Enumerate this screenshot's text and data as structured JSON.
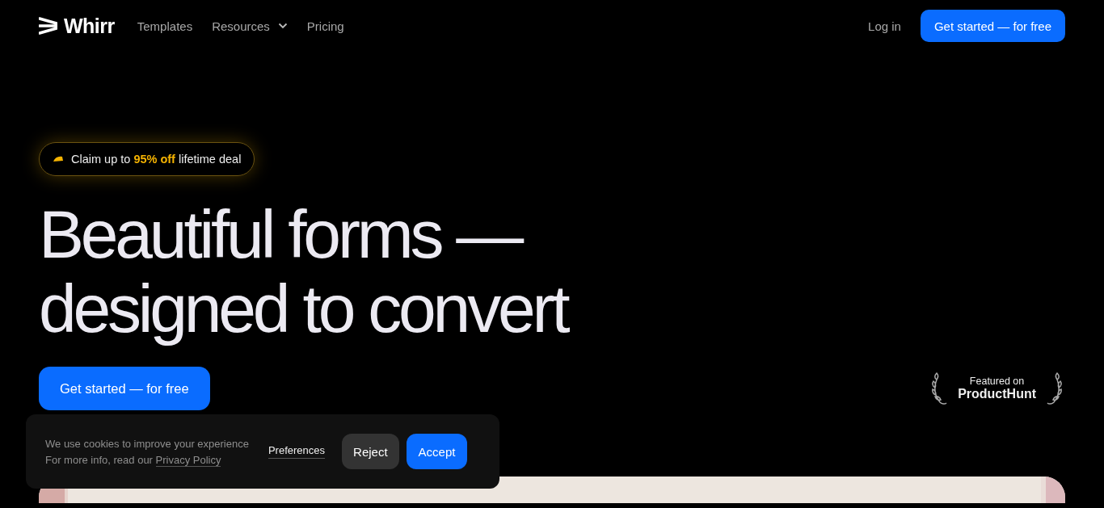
{
  "header": {
    "logo": "Whirr",
    "nav": [
      {
        "label": "Templates",
        "kind": "link"
      },
      {
        "label": "Resources",
        "kind": "dropdown"
      },
      {
        "label": "Pricing",
        "kind": "link"
      }
    ],
    "login": "Log in",
    "cta": "Get started — for free"
  },
  "hero": {
    "badge": "Claim up to **95% off** lifetime deal",
    "headline": [
      "Beautiful forms —",
      "designed to convert"
    ],
    "cta": "Get started — for free",
    "featured": {
      "label": "Featured on",
      "name": "ProductHunt"
    },
    "preview": {
      "kind": "picture"
    }
  },
  "cookie_banner": {
    "line_1": "We use cookies to improve your experience",
    "line_2": "For more info, read our",
    "link": "Privacy Policy",
    "preferences": "Preferences",
    "reject": "Reject",
    "accept": "Accept"
  }
}
